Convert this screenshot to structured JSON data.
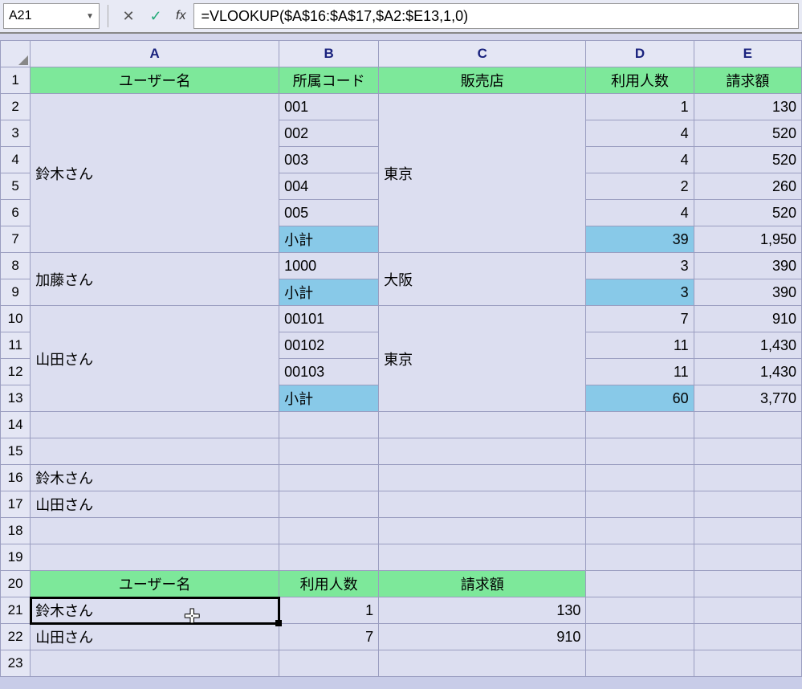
{
  "formula_bar": {
    "cell_ref": "A21",
    "fx_label": "fx",
    "formula": "=VLOOKUP($A$16:$A$17,$A2:$E13,1,0)"
  },
  "columns": [
    "A",
    "B",
    "C",
    "D",
    "E"
  ],
  "headers1": {
    "A": "ユーザー名",
    "B": "所属コード",
    "C": "販売店",
    "D": "利用人数",
    "E": "請求額"
  },
  "data_rows": [
    {
      "r": "2",
      "A": "",
      "B": "001",
      "C": "",
      "D": "1",
      "E": "130"
    },
    {
      "r": "3",
      "A": "",
      "B": "002",
      "C": "",
      "D": "4",
      "E": "520"
    },
    {
      "r": "4",
      "A": "鈴木さん",
      "B": "003",
      "C": "東京",
      "D": "4",
      "E": "520"
    },
    {
      "r": "5",
      "A": "",
      "B": "004",
      "C": "",
      "D": "2",
      "E": "260"
    },
    {
      "r": "6",
      "A": "",
      "B": "005",
      "C": "",
      "D": "4",
      "E": "520"
    },
    {
      "r": "7",
      "A": "",
      "B": "小計",
      "C": "",
      "D": "39",
      "E": "1,950"
    },
    {
      "r": "8",
      "A": "加藤さん",
      "B": "1000",
      "C": "大阪",
      "D": "3",
      "E": "390"
    },
    {
      "r": "9",
      "A": "",
      "B": "小計",
      "C": "",
      "D": "3",
      "E": "390"
    },
    {
      "r": "10",
      "A": "",
      "B": "00101",
      "C": "",
      "D": "7",
      "E": "910"
    },
    {
      "r": "11",
      "A": "山田さん",
      "B": "00102",
      "C": "東京",
      "D": "11",
      "E": "1,430"
    },
    {
      "r": "12",
      "A": "",
      "B": "00103",
      "C": "",
      "D": "11",
      "E": "1,430"
    },
    {
      "r": "13",
      "A": "",
      "B": "小計",
      "C": "",
      "D": "60",
      "E": "3,770"
    }
  ],
  "lookup_rows": {
    "r16": "鈴木さん",
    "r17": "山田さん"
  },
  "headers2": {
    "A": "ユーザー名",
    "B": "利用人数",
    "C": "請求額"
  },
  "result_rows": [
    {
      "r": "21",
      "A": "鈴木さん",
      "B": "1",
      "C": "130"
    },
    {
      "r": "22",
      "A": "山田さん",
      "B": "7",
      "C": "910"
    }
  ],
  "cursor_glyph": "✛"
}
